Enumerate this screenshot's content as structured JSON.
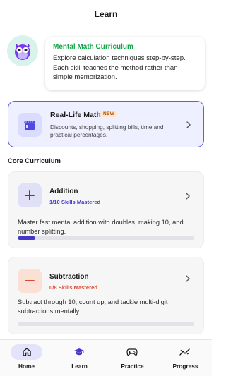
{
  "header": {
    "title": "Learn"
  },
  "intro": {
    "avatar_icon": "owl-mascot-icon",
    "title": "Mental Math Curriculum",
    "description": "Explore calculation techniques step-by-step. Each skill teaches the method rather than simple memorization."
  },
  "real_life": {
    "icon": "storefront-icon",
    "title": "Real-Life Math",
    "badge": "NEW",
    "description": "Discounts, shopping, splitting bills, time and practical percentages."
  },
  "section_title": "Core Curriculum",
  "courses": [
    {
      "icon": "plus-icon",
      "title": "Addition",
      "progress_label": "1/10 Skills Mastered",
      "progress": 0.1,
      "description": "Master fast mental addition with doubles, making 10, and number splitting.",
      "accent": "#4338ca",
      "icon_bg": "#e0e1f7"
    },
    {
      "icon": "minus-icon",
      "title": "Subtraction",
      "progress_label": "0/8 Skills Mastered",
      "progress": 0,
      "description": "Subtract through 10, count up, and tackle multi-digit subtractions mentally.",
      "accent": "#dc4b2f",
      "icon_bg": "#fbe0d6"
    }
  ],
  "nav": [
    {
      "label": "Home",
      "icon": "home-icon",
      "active": true
    },
    {
      "label": "Learn",
      "icon": "graduation-cap-icon",
      "active": false
    },
    {
      "label": "Practice",
      "icon": "gamepad-icon",
      "active": false
    },
    {
      "label": "Progress",
      "icon": "trend-chart-icon",
      "active": false
    }
  ]
}
